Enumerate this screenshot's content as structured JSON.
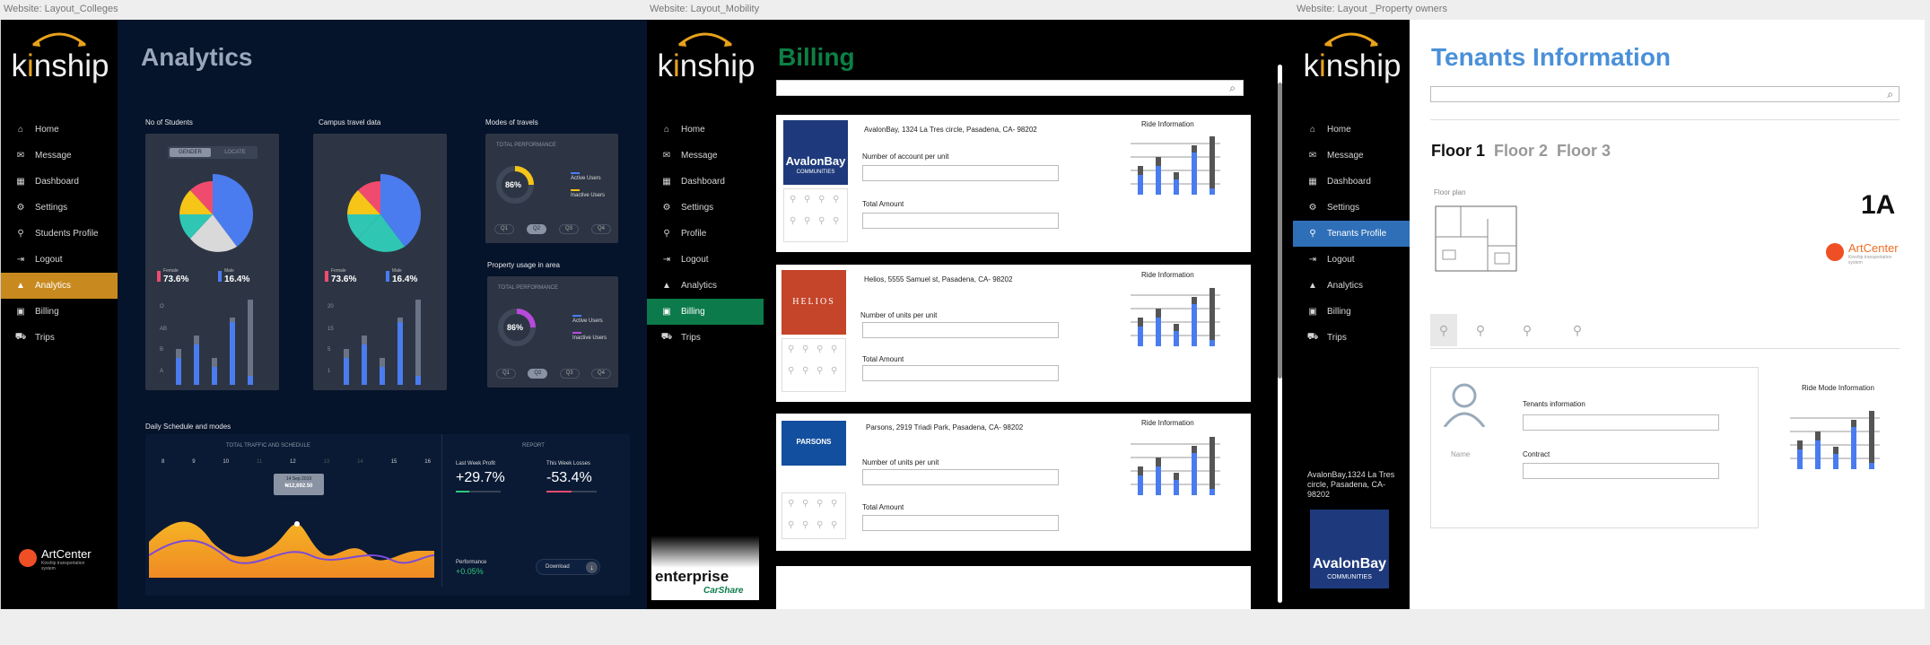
{
  "labels": {
    "colleges": "Website: Layout_Colleges",
    "mobility": "Website: Layout_Mobility",
    "property": "Website: Layout _Property owners"
  },
  "brand": {
    "logo_pre": "k",
    "logo_i": "i",
    "logo_post": "nship",
    "artcenter_title": "ArtCenter",
    "artcenter_sub": "Kinship transportation system"
  },
  "colleges": {
    "title": "Analytics",
    "nav": [
      {
        "label": "Home",
        "icon": "home-icon"
      },
      {
        "label": "Message",
        "icon": "mail-icon"
      },
      {
        "label": "Dashboard",
        "icon": "grid-icon"
      },
      {
        "label": "Settings",
        "icon": "gear-icon"
      },
      {
        "label": "Students Profile",
        "icon": "user-icon"
      },
      {
        "label": "Logout",
        "icon": "logout-icon"
      },
      {
        "label": "Analytics",
        "icon": "chart-icon",
        "active": true
      },
      {
        "label": "Billing",
        "icon": "bill-icon"
      },
      {
        "label": "Trips",
        "icon": "car-icon"
      }
    ],
    "students": {
      "label": "No of Students",
      "tab_gender": "GENDER",
      "tab_locate": "LOCATE",
      "female_label": "Female",
      "female_value": "73.6%",
      "male_label": "Male",
      "male_value": "16.4%",
      "y_ticks": [
        "O",
        "AB",
        "B",
        "A"
      ]
    },
    "campus": {
      "label": "Campus travel data",
      "female_label": "Female",
      "female_value": "73.6%",
      "male_label": "Male",
      "male_value": "16.4%",
      "y_ticks": [
        "20",
        "15",
        "5",
        "1"
      ]
    },
    "modes": {
      "label": "Modes of travels",
      "header": "TOTAL PERFORMANCE",
      "percent": "86%",
      "active": "Active Users",
      "inactive": "Inactive Users",
      "quarters": [
        "Q1",
        "Q2",
        "Q3",
        "Q4"
      ]
    },
    "property": {
      "label": "Property usage in area",
      "header": "TOTAL PERFORMANCE",
      "percent": "86%",
      "active": "Active Users",
      "inactive": "Inactive Users",
      "quarters": [
        "Q1",
        "Q2",
        "Q3",
        "Q4"
      ]
    },
    "schedule": {
      "label": "Daily Schedule and modes",
      "chart_header": "TOTAL TRAFFIC AND SCHEDULE",
      "x_ticks": [
        "8",
        "9",
        "10",
        "11",
        "12",
        "13",
        "14",
        "15",
        "16"
      ],
      "tooltip_date": "14 Sep 2019",
      "tooltip_value": "₦12,692.50"
    },
    "report": {
      "header": "REPORT",
      "profit_label": "Last Week Profit",
      "profit_value": "+29.7%",
      "losses_label": "This Week Losses",
      "losses_value": "-53.4%",
      "perf_label": "Performance",
      "perf_value": "+0.05%",
      "download": "Download"
    },
    "colors": {
      "bg": "#05132b",
      "card": "#2d3544",
      "accent": "#c88a1e",
      "blue": "#4a7cf0",
      "yellow": "#f5b324"
    }
  },
  "mobility": {
    "title": "Billing",
    "nav": [
      {
        "label": "Home",
        "icon": "home-icon"
      },
      {
        "label": "Message",
        "icon": "mail-icon"
      },
      {
        "label": "Dashboard",
        "icon": "grid-icon"
      },
      {
        "label": "Settings",
        "icon": "gear-icon"
      },
      {
        "label": "Profile",
        "icon": "user-icon"
      },
      {
        "label": "Logout",
        "icon": "logout-icon"
      },
      {
        "label": "Analytics",
        "icon": "chart-icon"
      },
      {
        "label": "Billing",
        "icon": "bill-icon",
        "active": true
      },
      {
        "label": "Trips",
        "icon": "car-icon"
      }
    ],
    "search_placeholder": "",
    "cards": [
      {
        "company": "AvalonBay, 1324 La Tres circle, Pasadena, CA- 98202",
        "logo": "AvalonBay",
        "logo_sub": "COMMUNITIES",
        "field1": "Number of account per unit",
        "field2": "Total Amount",
        "ride": "Ride Information"
      },
      {
        "company": "Helios, 5555 Samuel st, Pasadena, CA- 98202",
        "logo": "HELIOS",
        "logo_sub": "",
        "field1": "Number of units per unit",
        "field2": "Total Amount",
        "ride": "Ride Information"
      },
      {
        "company": "Parsons, 2919 Triadi Park, Pasadena, CA- 98202",
        "logo": "PARSONS",
        "logo_sub": "",
        "field1": "Number of units per unit",
        "field2": "Total Amount",
        "ride": "Ride Information"
      }
    ],
    "enterprise": {
      "name": "enterprise",
      "sub": "CarShare"
    },
    "colors": {
      "accent": "#0c7a4a",
      "title": "#0d7f45"
    }
  },
  "property": {
    "title": "Tenants Information",
    "nav": [
      {
        "label": "Home",
        "icon": "home-icon"
      },
      {
        "label": "Message",
        "icon": "mail-icon"
      },
      {
        "label": "Dashboard",
        "icon": "grid-icon"
      },
      {
        "label": "Settings",
        "icon": "gear-icon"
      },
      {
        "label": "Tenants Profile",
        "icon": "user-icon",
        "active": true
      },
      {
        "label": "Logout",
        "icon": "logout-icon"
      },
      {
        "label": "Analytics",
        "icon": "chart-icon"
      },
      {
        "label": "Billing",
        "icon": "bill-icon"
      },
      {
        "label": "Trips",
        "icon": "car-icon"
      }
    ],
    "floors": [
      "Floor 1",
      "Floor 2",
      "Floor 3"
    ],
    "floor_plan_label": "Floor plan",
    "unit": "1A",
    "tenant_info_label": "Tenants information",
    "contract_label": "Contract",
    "name_label": "Name",
    "ride_mode": "Ride Mode Information",
    "address": "AvalonBay,1324  La Tres circle, Pasadena, CA- 98202",
    "avalon_logo": "AvalonBay",
    "avalon_sub": "COMMUNITIES",
    "colors": {
      "title": "#4a90d9",
      "accent": "#2f6fb8"
    }
  }
}
